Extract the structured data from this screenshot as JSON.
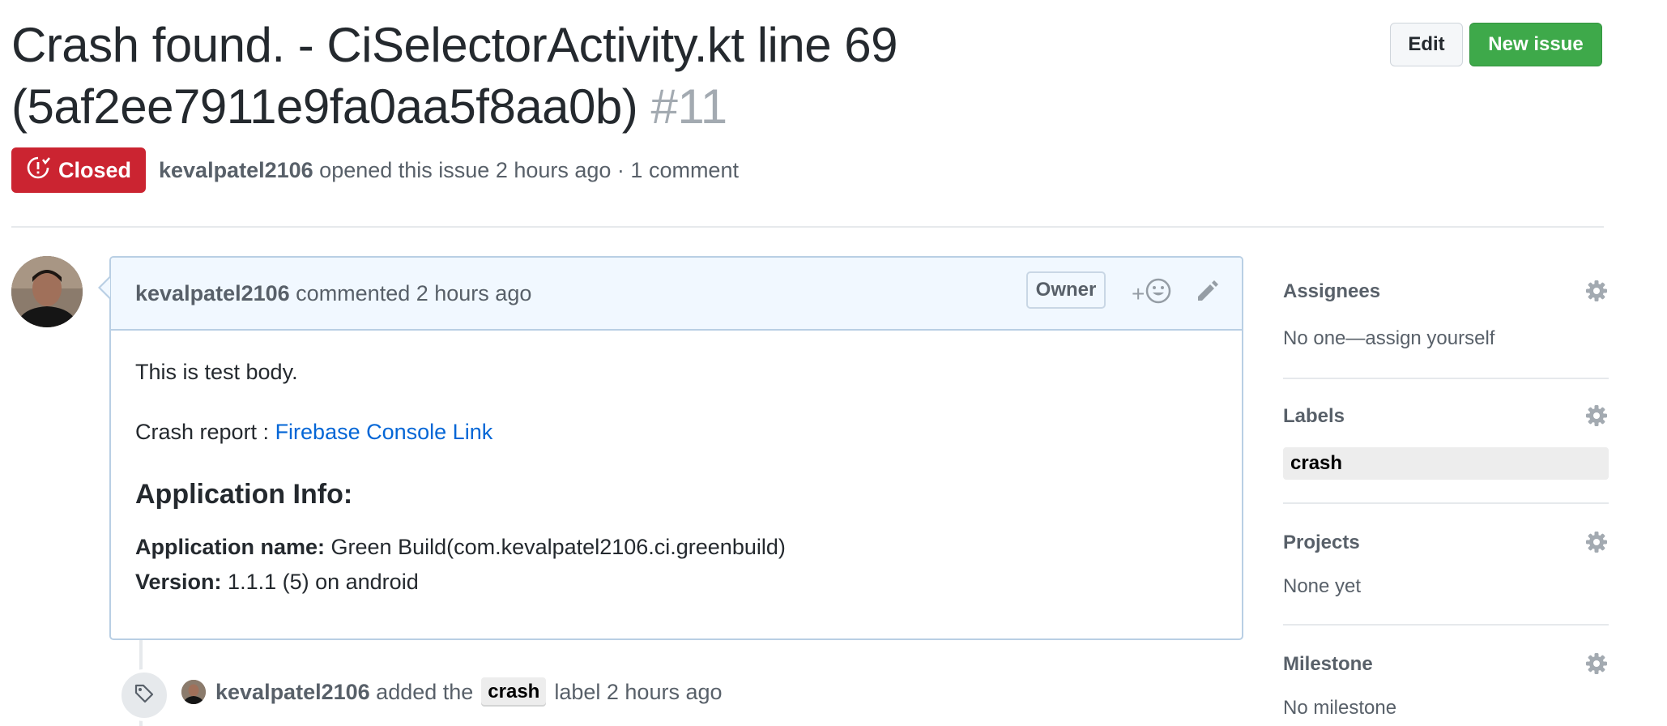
{
  "issue": {
    "title": "Crash found. - CiSelectorActivity.kt line 69 (5af2ee7911e9fa0aa5f8aa0b)",
    "number": "#11",
    "state": "Closed",
    "author": "kevalpatel2106",
    "opened_text": "opened this issue 2 hours ago · 1 comment"
  },
  "header_actions": {
    "edit_label": "Edit",
    "new_issue_label": "New issue"
  },
  "comment": {
    "author": "kevalpatel2106",
    "action_text": "commented 2 hours ago",
    "owner_badge": "Owner",
    "reaction_plus": "+",
    "body_text": "This is test body.",
    "crash_report_prefix": "Crash report : ",
    "crash_report_link": "Firebase Console Link",
    "app_info_heading": "Application Info:",
    "app_name_label": "Application name:",
    "app_name_value": " Green Build(com.kevalpatel2106.ci.greenbuild)",
    "version_label": "Version:",
    "version_value": " 1.1.1 (5) on android"
  },
  "timeline_event": {
    "author": "kevalpatel2106",
    "text_before": "added the",
    "label": "crash",
    "text_after": "label 2 hours ago"
  },
  "sidebar": {
    "assignees": {
      "heading": "Assignees",
      "value": "No one—assign yourself"
    },
    "labels": {
      "heading": "Labels",
      "chip": "crash"
    },
    "projects": {
      "heading": "Projects",
      "value": "None yet"
    },
    "milestone": {
      "heading": "Milestone",
      "value": "No milestone"
    }
  },
  "colors": {
    "closed_red": "#cb2431",
    "new_issue_green": "#3ea94a",
    "link_blue": "#0366d6",
    "comment_header_bg": "#f1f8ff",
    "comment_border": "#b9cfe4",
    "label_gray": "#ededed"
  },
  "icons": [
    "issue-closed-icon",
    "smiley-icon",
    "pencil-icon",
    "tag-icon",
    "gear-icon"
  ]
}
